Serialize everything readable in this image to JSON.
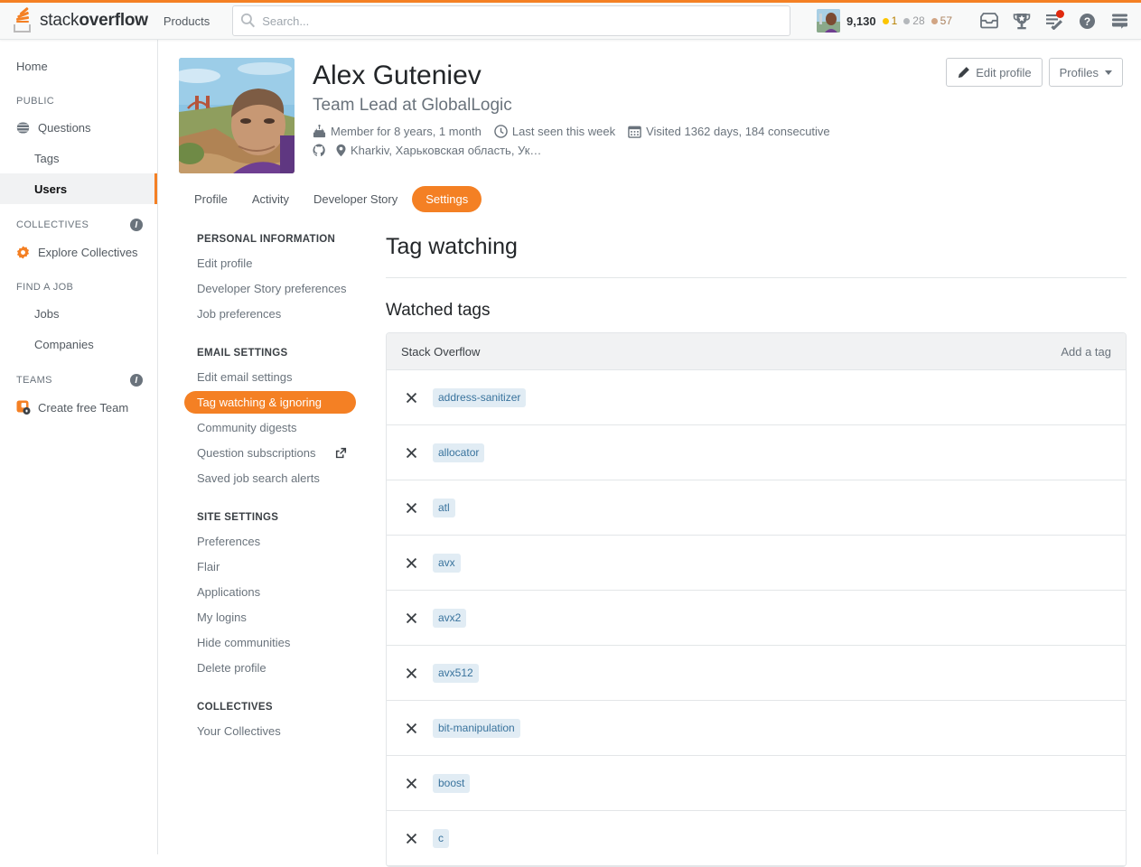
{
  "topnav": {
    "logo_text_light": "stack",
    "logo_text_bold": "overflow",
    "logo_icon": "stack-overflow-logo-icon",
    "products_label": "Products",
    "search": {
      "placeholder": "Search...",
      "value": "",
      "icon": "search-icon"
    },
    "reputation": "9,130",
    "badges": [
      {
        "type": "gold",
        "count": "1",
        "color": "#fcc501"
      },
      {
        "type": "silver",
        "count": "28",
        "color": "#b4b8bc"
      },
      {
        "type": "bronze",
        "count": "57",
        "color": "#d1a584"
      }
    ],
    "icons": [
      {
        "name": "inbox-icon"
      },
      {
        "name": "trophy-icon"
      },
      {
        "name": "review-queue-icon",
        "has_alert_dot": true
      },
      {
        "name": "help-icon"
      },
      {
        "name": "site-switcher-icon"
      }
    ],
    "accent_color": "#f48024"
  },
  "sidebar": {
    "home_label": "Home",
    "sections": [
      {
        "heading": "PUBLIC",
        "info": false,
        "items": [
          {
            "label": "Questions",
            "icon": "globe-icon",
            "indent": false,
            "active": false
          },
          {
            "label": "Tags",
            "icon": "",
            "indent": true,
            "active": false
          },
          {
            "label": "Users",
            "icon": "",
            "indent": true,
            "active": true
          }
        ]
      },
      {
        "heading": "COLLECTIVES",
        "info": true,
        "items": [
          {
            "label": "Explore Collectives",
            "icon": "collectives-icon",
            "indent": false,
            "active": false
          }
        ]
      },
      {
        "heading": "FIND A JOB",
        "info": false,
        "items": [
          {
            "label": "Jobs",
            "icon": "",
            "indent": true,
            "active": false
          },
          {
            "label": "Companies",
            "icon": "",
            "indent": true,
            "active": false
          }
        ]
      },
      {
        "heading": "TEAMS",
        "info": true,
        "items": [
          {
            "label": "Create free Team",
            "icon": "teams-icon",
            "indent": false,
            "active": false
          }
        ]
      }
    ]
  },
  "profile": {
    "avatar_name": "user-avatar",
    "name": "Alex Guteniev",
    "title": "Team Lead at GlobalLogic",
    "meta": [
      {
        "icon": "cake-icon",
        "text": "Member for 8 years, 1 month"
      },
      {
        "icon": "clock-icon",
        "text": "Last seen this week"
      },
      {
        "icon": "calendar-icon",
        "text": "Visited 1362 days, 184 consecutive"
      }
    ],
    "links": [
      {
        "icon": "github-icon",
        "text": ""
      },
      {
        "icon": "location-pin-icon",
        "text": "Kharkiv, Харьковская область, Ук…"
      }
    ],
    "edit_profile_label": "Edit profile",
    "edit_profile_icon": "pencil-icon",
    "profiles_label": "Profiles"
  },
  "tabs": [
    {
      "label": "Profile",
      "selected": false
    },
    {
      "label": "Activity",
      "selected": false
    },
    {
      "label": "Developer Story",
      "selected": false
    },
    {
      "label": "Settings",
      "selected": true
    }
  ],
  "settings_nav": [
    {
      "heading": "PERSONAL INFORMATION",
      "items": [
        {
          "label": "Edit profile",
          "selected": false,
          "external": false
        },
        {
          "label": "Developer Story preferences",
          "selected": false,
          "external": false
        },
        {
          "label": "Job preferences",
          "selected": false,
          "external": false
        }
      ]
    },
    {
      "heading": "EMAIL SETTINGS",
      "items": [
        {
          "label": "Edit email settings",
          "selected": false,
          "external": false
        },
        {
          "label": "Tag watching & ignoring",
          "selected": true,
          "external": false
        },
        {
          "label": "Community digests",
          "selected": false,
          "external": false
        },
        {
          "label": "Question subscriptions",
          "selected": false,
          "external": true
        },
        {
          "label": "Saved job search alerts",
          "selected": false,
          "external": false
        }
      ]
    },
    {
      "heading": "SITE SETTINGS",
      "items": [
        {
          "label": "Preferences",
          "selected": false,
          "external": false
        },
        {
          "label": "Flair",
          "selected": false,
          "external": false
        },
        {
          "label": "Applications",
          "selected": false,
          "external": false
        },
        {
          "label": "My logins",
          "selected": false,
          "external": false
        },
        {
          "label": "Hide communities",
          "selected": false,
          "external": false
        },
        {
          "label": "Delete profile",
          "selected": false,
          "external": false
        }
      ]
    },
    {
      "heading": "COLLECTIVES",
      "items": [
        {
          "label": "Your Collectives",
          "selected": false,
          "external": false
        }
      ]
    }
  ],
  "panel": {
    "title": "Tag watching",
    "section_title": "Watched tags",
    "table": {
      "site_label": "Stack Overflow",
      "add_tag_label": "Add a tag",
      "remove_icon": "close-icon",
      "tag_pill_bg": "#e1ecf4",
      "tag_pill_color": "#39739d",
      "rows": [
        {
          "tag": "address-sanitizer"
        },
        {
          "tag": "allocator"
        },
        {
          "tag": "atl"
        },
        {
          "tag": "avx"
        },
        {
          "tag": "avx2"
        },
        {
          "tag": "avx512"
        },
        {
          "tag": "bit-manipulation"
        },
        {
          "tag": "boost"
        },
        {
          "tag": "c"
        }
      ]
    }
  }
}
